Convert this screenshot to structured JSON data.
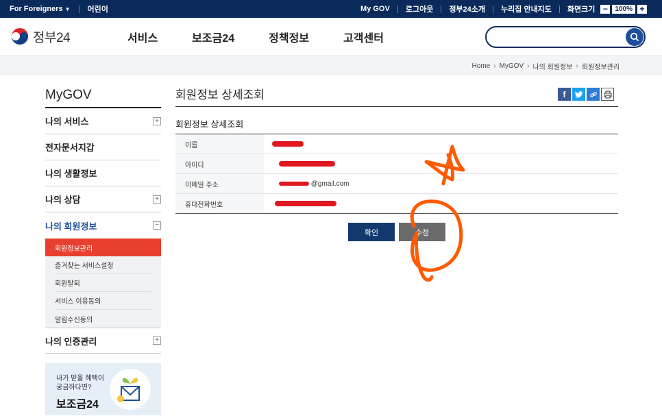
{
  "topbar": {
    "foreigners": "For Foreigners",
    "kids": "어린이",
    "links": [
      "My GOV",
      "로그아웃",
      "정부24소개",
      "누리집 안내지도"
    ],
    "screen_size_label": "화면크기",
    "zoom_minus": "−",
    "zoom_value": "100%",
    "zoom_plus": "+"
  },
  "header": {
    "logo_text": "정부24",
    "nav": [
      "서비스",
      "보조금24",
      "정책정보",
      "고객센터"
    ],
    "search_placeholder": ""
  },
  "breadcrumb": [
    "Home",
    "MyGOV",
    "나의 회원정보",
    "회원정보관리"
  ],
  "sidebar": {
    "title": "MyGOV",
    "items": [
      {
        "label": "나의 서비스",
        "toggle": "+"
      },
      {
        "label": "전자문서지갑",
        "toggle": ""
      },
      {
        "label": "나의 생활정보",
        "toggle": ""
      },
      {
        "label": "나의 상담",
        "toggle": "+"
      },
      {
        "label": "나의 회원정보",
        "toggle": "−"
      }
    ],
    "sub_items": [
      "회원정보관리",
      "즐겨찾는 서비스설정",
      "회원탈퇴",
      "서비스 이용동의",
      "알림수신동의"
    ],
    "last_item": {
      "label": "나의 인증관리",
      "toggle": "+"
    },
    "banner": {
      "question_line1": "내가 받을 혜택이",
      "question_line2": "궁금하다면?",
      "brand": "보조금24"
    }
  },
  "content": {
    "page_title": "회원정보 상세조회",
    "share_buttons": [
      "f",
      "t",
      "link",
      "print"
    ],
    "section_title": "회원정보 상세조회",
    "rows": [
      {
        "label": "이름",
        "value": ""
      },
      {
        "label": "아이디",
        "value": ""
      },
      {
        "label": "이메일 주소",
        "value": "@gmail.com"
      },
      {
        "label": "휴대전화번호",
        "value": ""
      }
    ],
    "confirm_label": "확인",
    "edit_label": "수정"
  },
  "colors": {
    "topbar": "#0b2a5c",
    "accent_blue": "#1d4f9c",
    "active_red": "#e8402e",
    "confirm_btn": "#133a6e",
    "edit_btn": "#6b6b6b",
    "annotation": "#ff5a00",
    "redaction": "#e0171f"
  }
}
